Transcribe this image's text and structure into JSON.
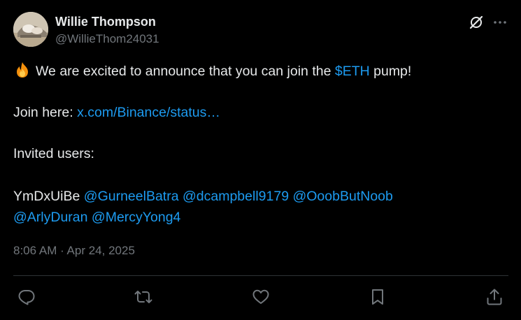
{
  "author": {
    "display_name": "Willie Thompson",
    "handle": "@WillieThom24031",
    "avatar_icon": "avatar-photo"
  },
  "header_actions": {
    "grok_icon": "grok-icon",
    "more_icon": "more-icon"
  },
  "post": {
    "line1": {
      "emoji": "fire-emoji",
      "text_before": "We are excited to announce that you can join the",
      "cashtag": "$ETH",
      "text_after": "pump!"
    },
    "line2": {
      "label": "Join here:",
      "link": "x.com/Binance/status…"
    },
    "line3": {
      "text": "Invited users:"
    },
    "line4": {
      "code": "YmDxUiBe",
      "mentions": [
        "@GurneelBatra",
        "@dcampbell9179",
        "@OoobButNoob"
      ]
    },
    "line5": {
      "mentions": [
        "@ArlyDuran",
        "@MercyYong4"
      ]
    }
  },
  "timestamp": "8:06 AM · Apr 24, 2025",
  "actions": [
    {
      "name": "reply",
      "icon": "reply-icon"
    },
    {
      "name": "repost",
      "icon": "repost-icon"
    },
    {
      "name": "like",
      "icon": "heart-icon"
    },
    {
      "name": "bookmark",
      "icon": "bookmark-icon"
    },
    {
      "name": "share",
      "icon": "share-icon"
    }
  ],
  "colors": {
    "background": "#000000",
    "text_primary": "#e7e9ea",
    "text_secondary": "#71767b",
    "link": "#1d9bf0",
    "divider": "#2f3336"
  }
}
